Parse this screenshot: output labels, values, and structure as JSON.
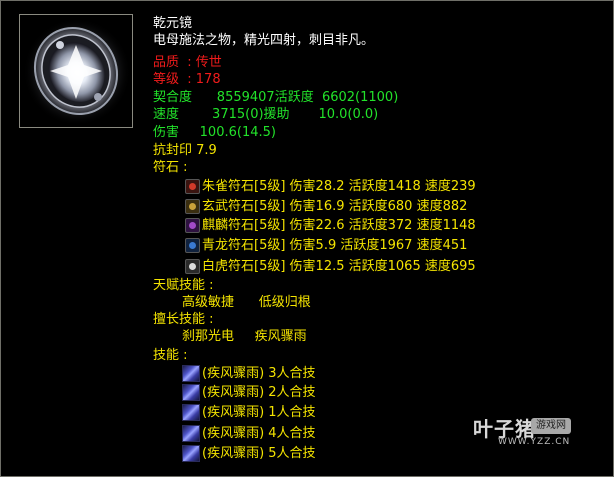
{
  "item": {
    "name": "乾元镜",
    "description": "电母施法之物，精光四射，刺目非凡。",
    "quality": "品质  : 传世",
    "level": "等级  : 178"
  },
  "stats": {
    "affinity": "契合度      8559407活跃度  6602(1100)",
    "speed": "速度        3715(0)援助       10.0(0.0)",
    "damage": "伤害     100.6(14.5)",
    "anti_seal": "抗封印 7.9"
  },
  "runes": {
    "header": "符石 :",
    "items": [
      {
        "text": "朱雀符石[5级] 伤害28.2 活跃度1418 速度239",
        "icon": "zhuque-rune-icon",
        "color": "#d23a2a"
      },
      {
        "text": "玄武符石[5级] 伤害16.9 活跃度680 速度882",
        "icon": "xuanwu-rune-icon",
        "color": "#caa23a"
      },
      {
        "text": "麒麟符石[5级] 伤害22.6 活跃度372 速度1148",
        "icon": "qilin-rune-icon",
        "color": "#a24ac8"
      },
      {
        "text": "青龙符石[5级] 伤害5.9 活跃度1967 速度451",
        "icon": "qinglong-rune-icon",
        "color": "#3a7ad2"
      },
      {
        "text": "白虎符石[5级] 伤害12.5 活跃度1065 速度695",
        "icon": "baihu-rune-icon",
        "color": "#dcdcdc"
      }
    ]
  },
  "talent": {
    "header": "天赋技能 :",
    "skills": "高级敏捷      低级归根"
  },
  "specialty": {
    "header": "擅长技能 :",
    "skills": "刹那光电     疾风骤雨"
  },
  "skills": {
    "header": "技能 :",
    "items": [
      {
        "text": "(疾风骤雨) 3人合技"
      },
      {
        "text": "(疾风骤雨) 2人合技"
      },
      {
        "text": "(疾风骤雨) 1人合技"
      },
      {
        "text": "(疾风骤雨) 4人合技"
      },
      {
        "text": "(疾风骤雨) 5人合技"
      }
    ]
  },
  "watermark": {
    "main": "叶子猪",
    "badge": "游戏网",
    "url": "WWW.YZZ.CN"
  },
  "colors": {
    "background": "#000000",
    "name": "#ffffff",
    "quality": "#f01b1b",
    "stats": "#22e22a",
    "body": "#f4e400",
    "border": "#6f6f68"
  }
}
